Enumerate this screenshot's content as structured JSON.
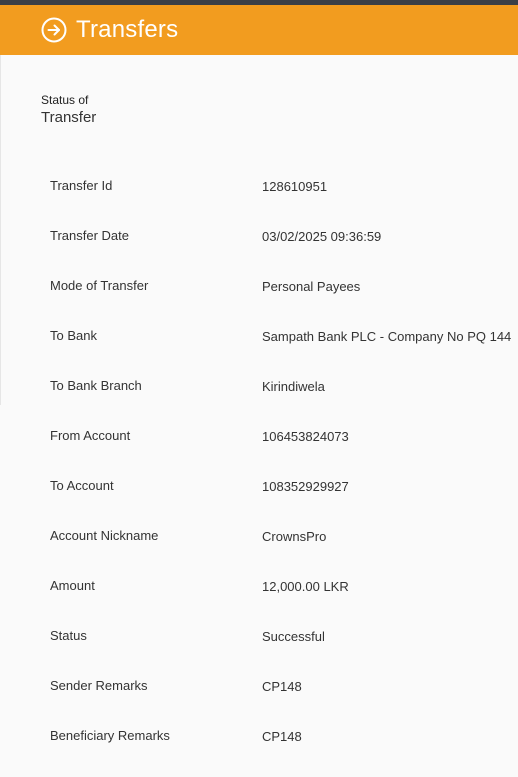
{
  "header": {
    "title": "Transfers",
    "icon": "arrow-right-circle-icon",
    "background_color": "#f29c1f",
    "strip_color": "#3a3f47"
  },
  "section": {
    "title_small": "Status of",
    "title_big": "Transfer"
  },
  "details": [
    {
      "label": "Transfer Id",
      "value": "128610951"
    },
    {
      "label": "Transfer Date",
      "value": "03/02/2025 09:36:59"
    },
    {
      "label": "Mode of Transfer",
      "value": "Personal Payees"
    },
    {
      "label": "To Bank",
      "value": "Sampath Bank PLC - Company No PQ 144"
    },
    {
      "label": "To Bank Branch",
      "value": "Kirindiwela"
    },
    {
      "label": "From Account",
      "value": "106453824073"
    },
    {
      "label": "To Account",
      "value": "108352929927"
    },
    {
      "label": "Account Nickname",
      "value": "CrownsPro"
    },
    {
      "label": "Amount",
      "value": "12,000.00 LKR"
    },
    {
      "label": "Status",
      "value": "Successful"
    },
    {
      "label": "Sender Remarks",
      "value": "CP148"
    },
    {
      "label": "Beneficiary Remarks",
      "value": "CP148"
    }
  ]
}
